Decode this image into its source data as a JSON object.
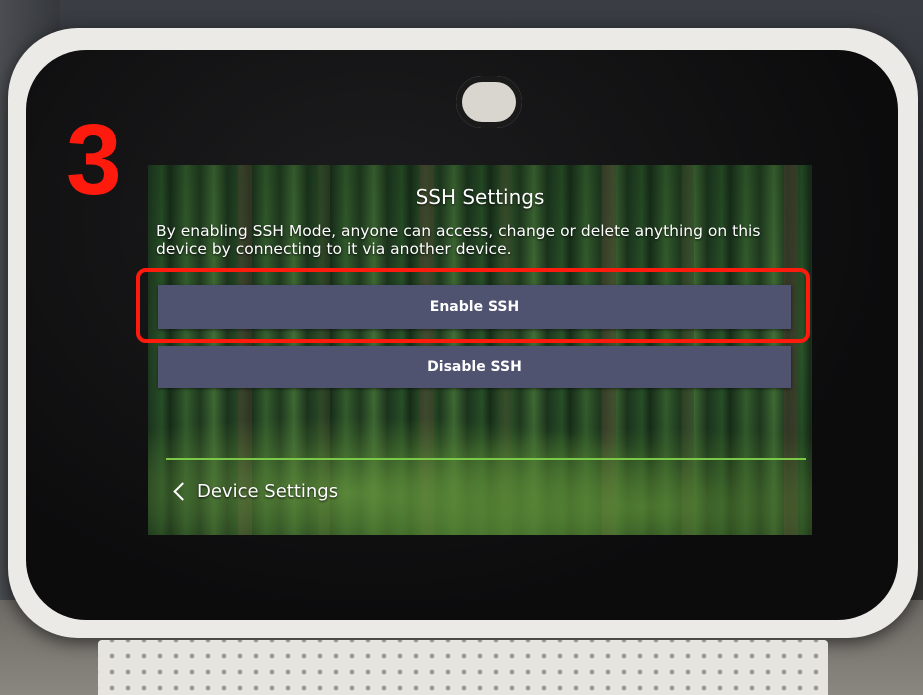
{
  "screen": {
    "title": "SSH Settings",
    "description": "By enabling SSH Mode, anyone can access, change or delete anything on this device by connecting to it via another device.",
    "buttons": {
      "enable_label": "Enable SSH",
      "disable_label": "Disable SSH"
    },
    "back": {
      "label": "Device Settings",
      "icon": "chevron-left-icon"
    }
  },
  "annotation": {
    "step_number": "3",
    "highlight_color": "#ff1a0e"
  },
  "colors": {
    "button_bg": "#4f5370",
    "divider": "#7cc94a"
  }
}
